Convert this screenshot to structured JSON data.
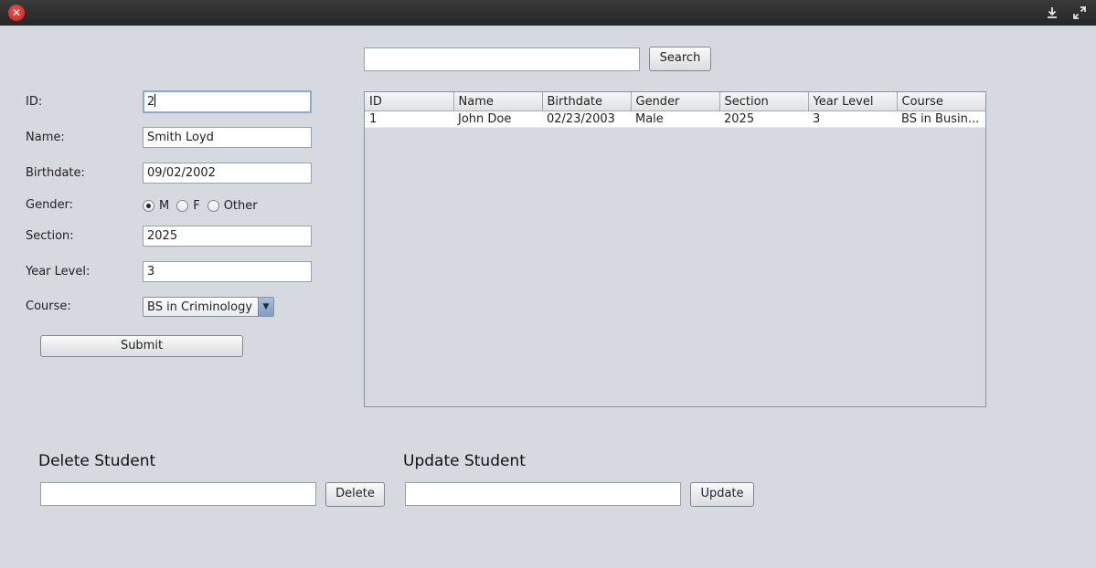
{
  "window": {
    "close_glyph": "✕",
    "icons": [
      "close-icon",
      "minimize-icon",
      "maximize-icon"
    ]
  },
  "search": {
    "value": "",
    "button_label": "Search"
  },
  "form": {
    "id_label": "ID:",
    "id_value": "2",
    "name_label": "Name:",
    "name_value": "Smith Loyd",
    "birthdate_label": "Birthdate:",
    "birthdate_value": "09/02/2002",
    "gender_label": "Gender:",
    "gender_options": [
      "M",
      "F",
      "Other"
    ],
    "gender_selected": "M",
    "section_label": "Section:",
    "section_value": "2025",
    "year_label": "Year Level:",
    "year_value": "3",
    "course_label": "Course:",
    "course_value": "BS in Criminology",
    "submit_label": "Submit"
  },
  "table": {
    "columns": [
      "ID",
      "Name",
      "Birthdate",
      "Gender",
      "Section",
      "Year Level",
      "Course"
    ],
    "rows": [
      [
        "1",
        "John Doe",
        "02/23/2003",
        "Male",
        "2025",
        "3",
        "BS in Busin..."
      ]
    ]
  },
  "delete_panel": {
    "title": "Delete Student",
    "value": "",
    "button_label": "Delete"
  },
  "update_panel": {
    "title": "Update Student",
    "value": "",
    "button_label": "Update"
  },
  "colors": {
    "background": "#d6d9df",
    "titlebar": "#2b2b2b",
    "close": "#e53935",
    "focus": "#8fa9c9"
  }
}
